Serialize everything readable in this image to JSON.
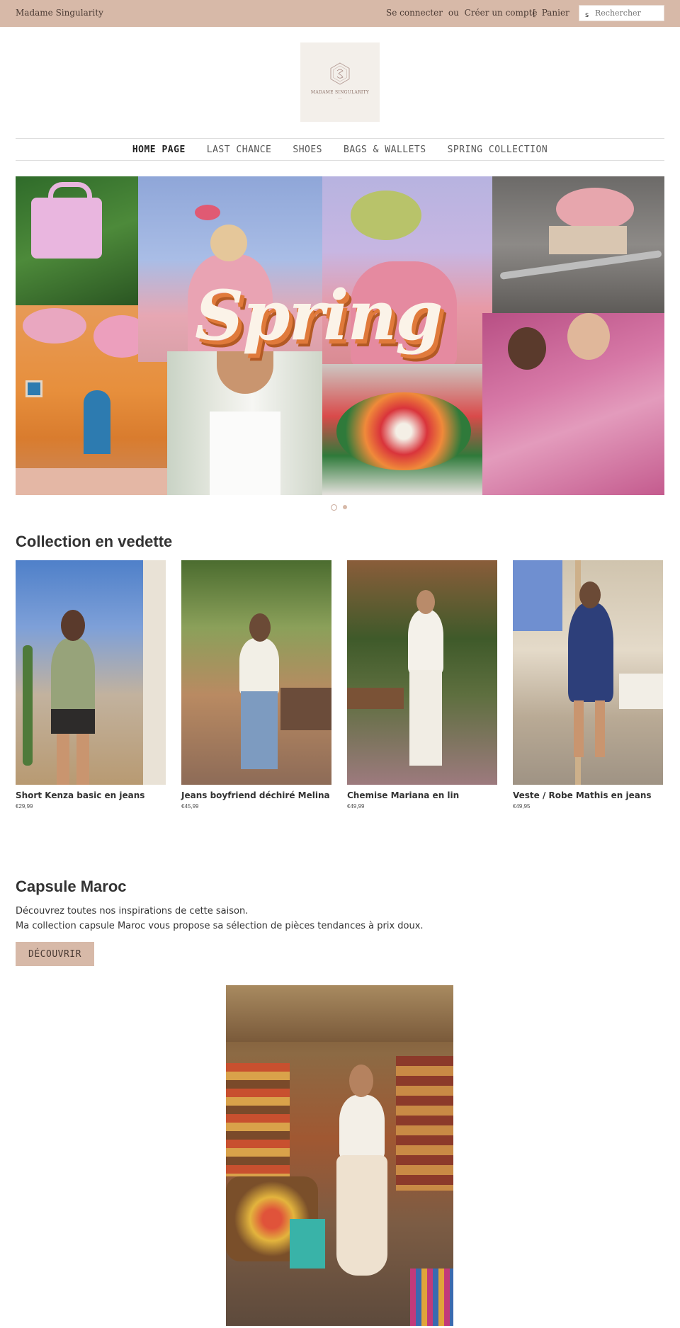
{
  "header": {
    "shop_name": "Madame Singularity",
    "login": "Se connecter",
    "or": "ou",
    "register": "Créer un compte",
    "cart_bracket": "[",
    "cart": "Panier",
    "search_icon_glyph": "s",
    "search_placeholder": "Rechercher"
  },
  "logo": {
    "name": "MADAME SINGULARITY"
  },
  "nav": {
    "items": [
      {
        "label": "HOME PAGE",
        "active": true
      },
      {
        "label": "LAST CHANCE",
        "active": false
      },
      {
        "label": "SHOES",
        "active": false
      },
      {
        "label": "BAGS & WALLETS",
        "active": false
      },
      {
        "label": "SPRING COLLECTION",
        "active": false
      }
    ]
  },
  "hero": {
    "headline": "Spring",
    "slide_count": 2,
    "active_slide": 1
  },
  "featured": {
    "title": "Collection en vedette",
    "products": [
      {
        "name": "Short Kenza basic en jeans",
        "price": "€29,99"
      },
      {
        "name": "Jeans boyfriend déchiré Melina",
        "price": "€45,99"
      },
      {
        "name": "Chemise Mariana en lin",
        "price": "€49,99"
      },
      {
        "name": "Veste / Robe Mathis en jeans",
        "price": "€49,95"
      }
    ]
  },
  "capsule": {
    "title": "Capsule Maroc",
    "line1": "Découvrez toutes nos inspirations de cette saison.",
    "line2": "Ma collection capsule Maroc vous propose sa sélection de pièces tendances à prix doux.",
    "button": "DÉCOUVRIR"
  },
  "colors": {
    "accent": "#d7b9a8",
    "text": "#333333"
  }
}
